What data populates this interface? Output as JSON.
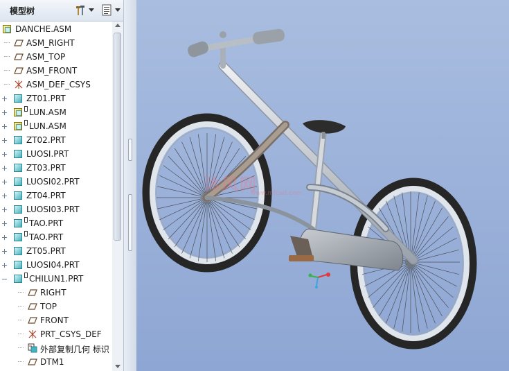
{
  "model_tree": {
    "title": "模型树",
    "settings_icon": "tree-settings-icon",
    "show_icon": "tree-show-icon",
    "items": [
      {
        "label": "DANCHE.ASM",
        "icon": "assembly-icon",
        "level": 0,
        "expander": "none"
      },
      {
        "label": "ASM_RIGHT",
        "icon": "datum-plane-icon",
        "level": 1,
        "expander": "none"
      },
      {
        "label": "ASM_TOP",
        "icon": "datum-plane-icon",
        "level": 1,
        "expander": "none"
      },
      {
        "label": "ASM_FRONT",
        "icon": "datum-plane-icon",
        "level": 1,
        "expander": "none"
      },
      {
        "label": "ASM_DEF_CSYS",
        "icon": "csys-icon",
        "level": 1,
        "expander": "none"
      },
      {
        "label": "ZT01.PRT",
        "icon": "part-icon",
        "level": 1,
        "expander": "plus"
      },
      {
        "label": "LUN.ASM",
        "icon": "assembly-icon",
        "level": 1,
        "expander": "plus",
        "badge": true
      },
      {
        "label": "LUN.ASM",
        "icon": "assembly-icon",
        "level": 1,
        "expander": "plus",
        "badge": true
      },
      {
        "label": "ZT02.PRT",
        "icon": "part-icon",
        "level": 1,
        "expander": "plus"
      },
      {
        "label": "LUOSI.PRT",
        "icon": "part-icon",
        "level": 1,
        "expander": "plus"
      },
      {
        "label": "ZT03.PRT",
        "icon": "part-icon",
        "level": 1,
        "expander": "plus"
      },
      {
        "label": "LUOSI02.PRT",
        "icon": "part-icon",
        "level": 1,
        "expander": "plus"
      },
      {
        "label": "ZT04.PRT",
        "icon": "part-icon",
        "level": 1,
        "expander": "plus"
      },
      {
        "label": "LUOSI03.PRT",
        "icon": "part-icon",
        "level": 1,
        "expander": "plus"
      },
      {
        "label": "TAO.PRT",
        "icon": "part-icon",
        "level": 1,
        "expander": "plus",
        "badge": true
      },
      {
        "label": "TAO.PRT",
        "icon": "part-icon",
        "level": 1,
        "expander": "plus",
        "badge": true
      },
      {
        "label": "ZT05.PRT",
        "icon": "part-icon",
        "level": 1,
        "expander": "plus"
      },
      {
        "label": "LUOSI04.PRT",
        "icon": "part-icon",
        "level": 1,
        "expander": "plus"
      },
      {
        "label": "CHILUN1.PRT",
        "icon": "part-icon",
        "level": 1,
        "expander": "minus",
        "badge": true
      },
      {
        "label": "RIGHT",
        "icon": "datum-plane-icon",
        "level": 2,
        "expander": "none"
      },
      {
        "label": "TOP",
        "icon": "datum-plane-icon",
        "level": 2,
        "expander": "none"
      },
      {
        "label": "FRONT",
        "icon": "datum-plane-icon",
        "level": 2,
        "expander": "none"
      },
      {
        "label": "PRT_CSYS_DEF",
        "icon": "csys-icon",
        "level": 2,
        "expander": "none"
      },
      {
        "label": "外部复制几何 标识",
        "icon": "external-copy-geometry-icon",
        "level": 2,
        "expander": "none"
      },
      {
        "label": "DTM1",
        "icon": "datum-plane-icon",
        "level": 2,
        "expander": "none"
      }
    ]
  },
  "viewport": {
    "background_top": "#a9bde0",
    "background_bottom": "#8ea6d3",
    "model": "bicycle",
    "watermark": "沐风网",
    "watermark_sub": "www.mfcad.com"
  },
  "colors": {
    "frame": "#c3c9d1",
    "tire": "#2a2a2a",
    "rim": "#e8ecef",
    "triad_x": "#e0383a",
    "triad_y": "#35b34a",
    "triad_z": "#3aa6e0"
  }
}
